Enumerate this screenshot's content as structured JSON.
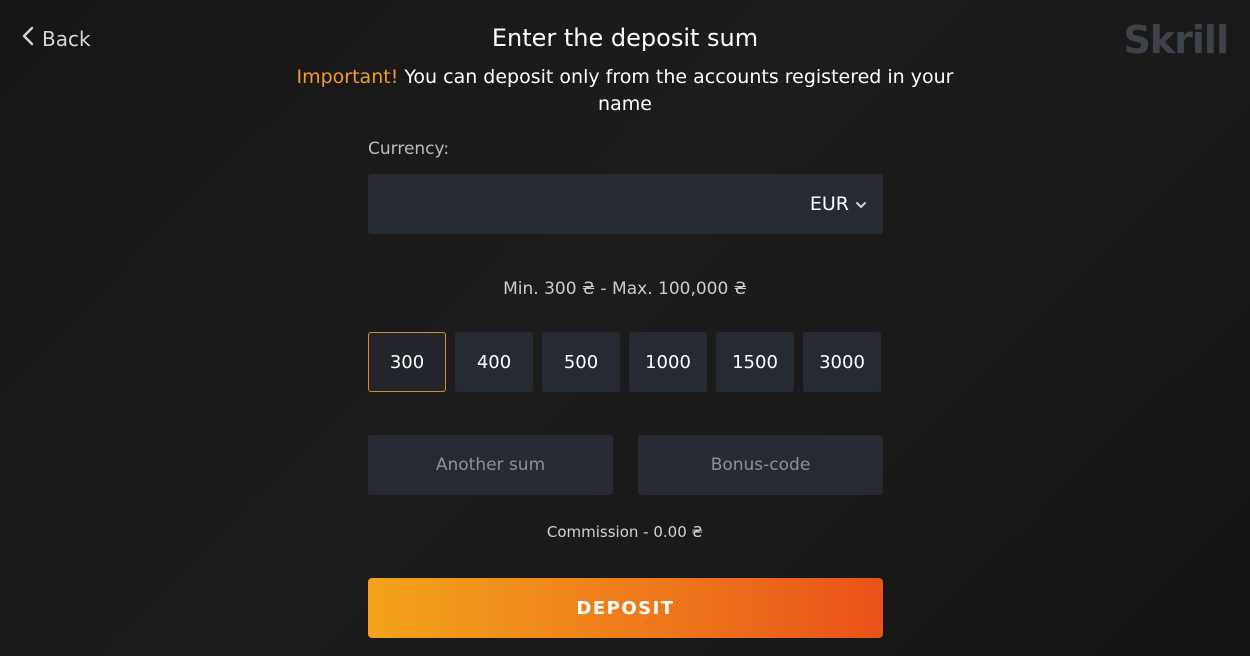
{
  "header": {
    "back_label": "Back",
    "logo_text": "Skrill",
    "title": "Enter the deposit sum"
  },
  "notice": {
    "important": "Important!",
    "text": " You can deposit only from the accounts registered in your name"
  },
  "currency": {
    "label": "Currency:",
    "selected": "EUR"
  },
  "limits_text": "Min. 300 ₴ - Max. 100,000 ₴",
  "amounts": [
    {
      "label": "300",
      "selected": true
    },
    {
      "label": "400",
      "selected": false
    },
    {
      "label": "500",
      "selected": false
    },
    {
      "label": "1000",
      "selected": false
    },
    {
      "label": "1500",
      "selected": false
    },
    {
      "label": "3000",
      "selected": false
    }
  ],
  "inputs": {
    "another_sum_placeholder": "Another sum",
    "bonus_code_placeholder": "Bonus-code"
  },
  "commission_text": "Commission - 0.00 ₴",
  "deposit_label": "DEPOSIT",
  "colors": {
    "accent": "#f29a2a",
    "button_gradient_start": "#f2a31b",
    "button_gradient_end": "#e9521a",
    "field_bg": "#262b33"
  },
  "icons": {
    "back": "chevron-left-icon",
    "currency_dropdown": "chevron-down-icon"
  }
}
